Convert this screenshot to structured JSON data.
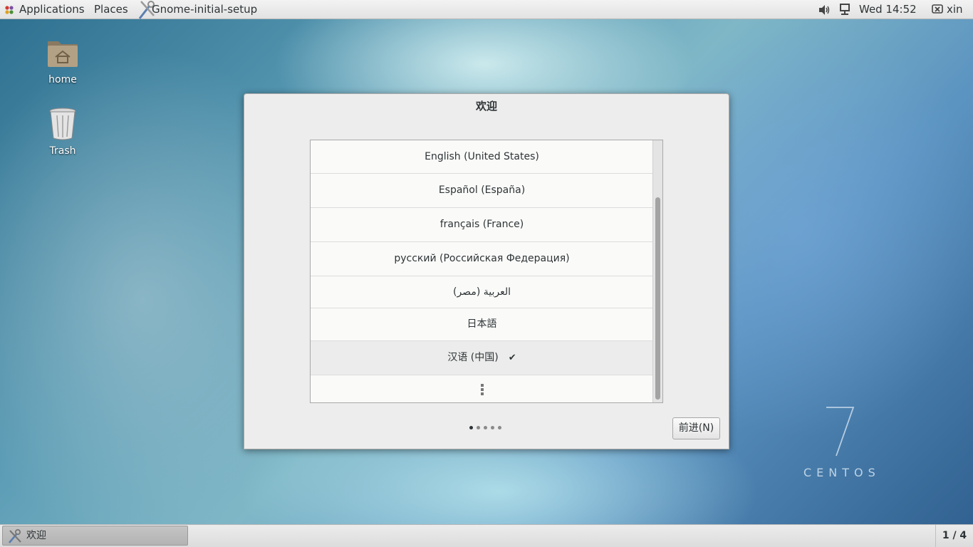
{
  "topbar": {
    "applications_label": "Applications",
    "places_label": "Places",
    "window_label": "Gnome-initial-setup",
    "clock": "Wed 14:52",
    "user": "xin"
  },
  "desktop": {
    "icons": [
      {
        "label": "home",
        "icon": "home-folder-icon"
      },
      {
        "label": "Trash",
        "icon": "trash-icon"
      }
    ],
    "watermark": {
      "number": "7",
      "text": "CENTOS"
    }
  },
  "dialog": {
    "title": "欢迎",
    "languages": [
      {
        "label": "English (United States)",
        "selected": false
      },
      {
        "label": "Español (España)",
        "selected": false
      },
      {
        "label": "français (France)",
        "selected": false
      },
      {
        "label": "русский (Российская Федерация)",
        "selected": false
      },
      {
        "label": "العربية (مصر)",
        "selected": false
      },
      {
        "label": "日本語",
        "selected": false
      },
      {
        "label": "汉语 (中国)",
        "selected": true
      }
    ],
    "check_mark": "✔",
    "pages": {
      "total": 5,
      "current": 1
    },
    "next_button": "前进(N)"
  },
  "taskbar": {
    "window_label": "欢迎",
    "workspace": "1 / 4"
  },
  "colors": {
    "panel_bg": "#e6e6e6",
    "dialog_bg": "#ededed",
    "list_bg": "#fafaf9",
    "text": "#2e3436"
  }
}
